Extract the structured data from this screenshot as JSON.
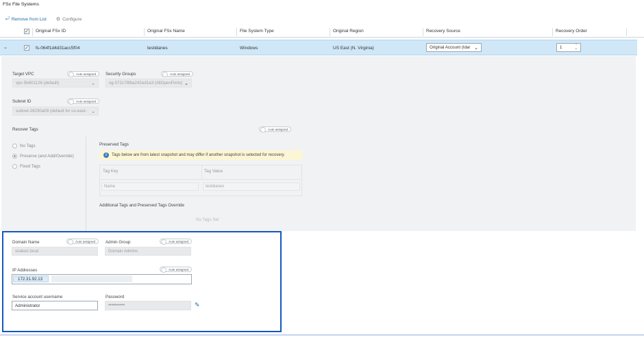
{
  "page_title": "FSx File Systems",
  "toolbar": {
    "remove_label": "Remove from List",
    "configure_label": "Configure"
  },
  "table": {
    "headers": [
      "Original FSx ID",
      "Original FSx Name",
      "File System Type",
      "Original Region",
      "Recovery Source",
      "Recovery Order"
    ],
    "row": {
      "id": "fs-064f1d4d31acc5f04",
      "name": "testidanes",
      "type": "Windows",
      "region": "US East (N. Virginia)",
      "recovery_source": "Original Account (Idar",
      "recovery_order": "1"
    }
  },
  "details": {
    "auto_assigned": "Auto assigned",
    "target_vpc": {
      "label": "Target VPC",
      "value": "vpc-5b601126 (default)"
    },
    "security_groups": {
      "label": "Security Groups",
      "value": "sg-072c78fba242ed1a3 (AllOpenPorts("
    },
    "subnet": {
      "label": "Subnet ID",
      "value": "subnet-28290a09 (default for us-east-"
    },
    "recover_tags": {
      "label": "Recover Tags",
      "options": [
        "No Tags",
        "Preserve (and Add/Override)",
        "Fixed Tags"
      ],
      "selected": 1
    },
    "preserved_tags": {
      "label": "Preserved Tags",
      "info": "Tags below are from latest snapshot and may differ if another snapshot is selected for recovery.",
      "col_key": "Tag Key",
      "col_value": "Tag Value",
      "row_key": "Name",
      "row_value": "testidanes"
    },
    "additional_tags": {
      "label": "Additional Tags and Preserved Tags Override",
      "empty": "No Tags Set"
    }
  },
  "domain": {
    "domain_name": {
      "label": "Domain Name",
      "value": "snakez.local"
    },
    "admin_group": {
      "label": "Admin Group",
      "value": "Domain Admins"
    },
    "ip_addresses": {
      "label": "IP Addresses",
      "value": "172.31.92.13"
    },
    "username": {
      "label": "Service account username",
      "value": "Administrator"
    },
    "password": {
      "label": "Password",
      "value": "**********"
    }
  }
}
